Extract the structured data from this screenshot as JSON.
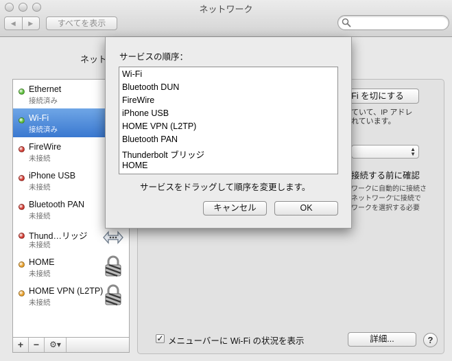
{
  "window": {
    "title": "ネットワーク"
  },
  "toolbar": {
    "back_glyph": "◀",
    "forward_glyph": "▶",
    "show_all_label": "すべてを表示",
    "search_placeholder": ""
  },
  "location": {
    "label": "ネットワ"
  },
  "services": [
    {
      "name": "Ethernet",
      "status": "接続済み",
      "dot_color": "#5cbf3a",
      "selected": false
    },
    {
      "name": "Wi-Fi",
      "status": "接続済み",
      "dot_color": "#5cbf3a",
      "selected": true
    },
    {
      "name": "FireWire",
      "status": "未接続",
      "dot_color": "#d23a31",
      "selected": false
    },
    {
      "name": "iPhone USB",
      "status": "未接続",
      "dot_color": "#d23a31",
      "selected": false
    },
    {
      "name": "Bluetooth PAN",
      "status": "未接続",
      "dot_color": "#d23a31",
      "selected": false
    },
    {
      "name": "Thund…リッジ",
      "status": "未接続",
      "dot_color": "#d23a31",
      "selected": false,
      "icon": "bridge-arrows-icon"
    },
    {
      "name": "HOME",
      "status": "未接続",
      "dot_color": "#e9a02a",
      "selected": false,
      "icon": "lock-icon"
    },
    {
      "name": "HOME VPN (L2TP)",
      "status": "未接続",
      "dot_color": "#e9a02a",
      "selected": false,
      "icon": "lock-icon"
    }
  ],
  "list_controls": {
    "add": "+",
    "remove": "−",
    "gear": "⚙▾"
  },
  "detail": {
    "wifi_off_button": "Fi を切にする",
    "text_line_1": "ていて、IP アドレ",
    "text_line_2": "れています。",
    "network_select_value": "",
    "ask_label": "接続する前に確認",
    "small_line_1": "ワークに自動的に接続さ",
    "small_line_2": "ネットワーク'に接続で",
    "small_line_3": "ワークを選択する必要",
    "menubar_check": "✓",
    "menubar_label": "メニューバーに Wi-Fi の状況を表示",
    "advanced_button": "詳細...",
    "help_button": "?"
  },
  "sheet": {
    "title": "サービスの順序：",
    "order": [
      "Wi-Fi",
      "Bluetooth DUN",
      "FireWire",
      "iPhone USB",
      "HOME VPN (L2TP)",
      "Bluetooth PAN",
      "Thunderbolt ブリッジ",
      "HOME"
    ],
    "hint": "サービスをドラッグして順序を変更します。",
    "cancel_label": "キャンセル",
    "ok_label": "OK"
  }
}
